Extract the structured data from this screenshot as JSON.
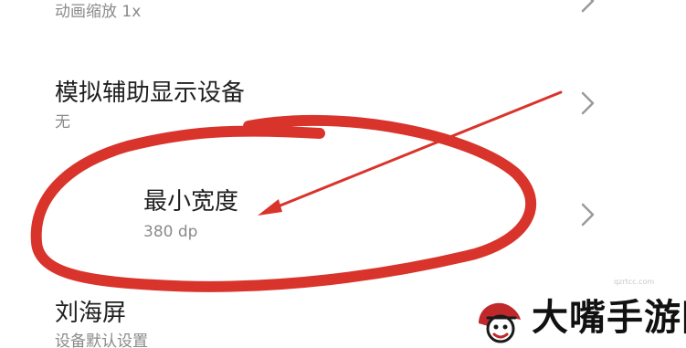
{
  "settings": {
    "items": [
      {
        "title": "",
        "subtitle": "动画缩放 1x"
      },
      {
        "title": "模拟辅助显示设备",
        "subtitle": "无"
      },
      {
        "title": "最小宽度",
        "subtitle": "380 dp"
      },
      {
        "title": "刘海屏",
        "subtitle": "设备默认设置"
      }
    ]
  },
  "annotation": {
    "color": "#d9342b"
  },
  "watermark": {
    "brand": "大嘴手游网",
    "small": "qzrtcc.com"
  },
  "icons": {
    "chevron": "chevron-right-icon",
    "logo": "dazui-logo-icon"
  }
}
